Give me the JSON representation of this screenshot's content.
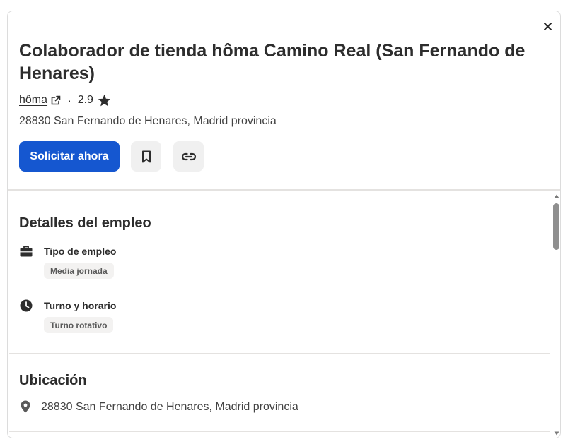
{
  "header": {
    "close_icon": "close-icon",
    "job_title": "Colaborador de tienda hôma Camino Real (San Fernando de Henares)",
    "company_name": "hôma",
    "external_link_icon": "external-link-icon",
    "separator": "·",
    "rating": "2.9",
    "rating_icon": "star-icon",
    "location": "28830 San Fernando de Henares, Madrid provincia",
    "apply_label": "Solicitar ahora",
    "save_icon": "bookmark-icon",
    "copy_link_icon": "link-icon",
    "apply_color": "#1557d0"
  },
  "details": {
    "title": "Detalles del empleo",
    "job_type": {
      "icon": "briefcase-icon",
      "label": "Tipo de empleo",
      "tag": "Media jornada"
    },
    "schedule": {
      "icon": "clock-icon",
      "label": "Turno y horario",
      "tag": "Turno rotativo"
    }
  },
  "location_section": {
    "title": "Ubicación",
    "icon": "location-pin-icon",
    "address": "28830 San Fernando de Henares, Madrid provincia"
  }
}
